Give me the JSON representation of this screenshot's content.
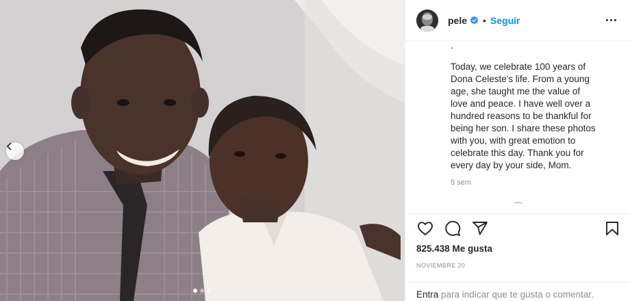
{
  "photo": {
    "alt_icon": "chevron-left-icon",
    "carousel_dots": 3,
    "active_dot": 0
  },
  "header": {
    "username": "pele",
    "verified_icon": "verified-badge-icon",
    "separator": "•",
    "follow_label": "Seguir",
    "more_icon": "more-horizontal-icon"
  },
  "post": {
    "dot_line": ".",
    "caption": "Today, we celebrate 100 years of Dona Celeste's life. From a young age, she taught me the value of love and peace. I have well over a hundred reasons to be thankful for being her son. I share these photos with you, with great emotion to celebrate this day. Thank you for every day by your side, Mom.",
    "time_ago": "5 sem"
  },
  "actions": {
    "like_icon": "heart-icon",
    "comment_icon": "comment-icon",
    "share_icon": "share-icon",
    "save_icon": "bookmark-icon"
  },
  "stats": {
    "likes": "825.438 Me gusta",
    "date": "NOVIEMBRE 20"
  },
  "comment": {
    "login_link": "Entra",
    "prompt": " para indicar que te gusta o comentar."
  },
  "colors": {
    "accent": "#0095f6",
    "text": "#262626",
    "muted": "#8e8e8e",
    "border": "#efefef"
  }
}
